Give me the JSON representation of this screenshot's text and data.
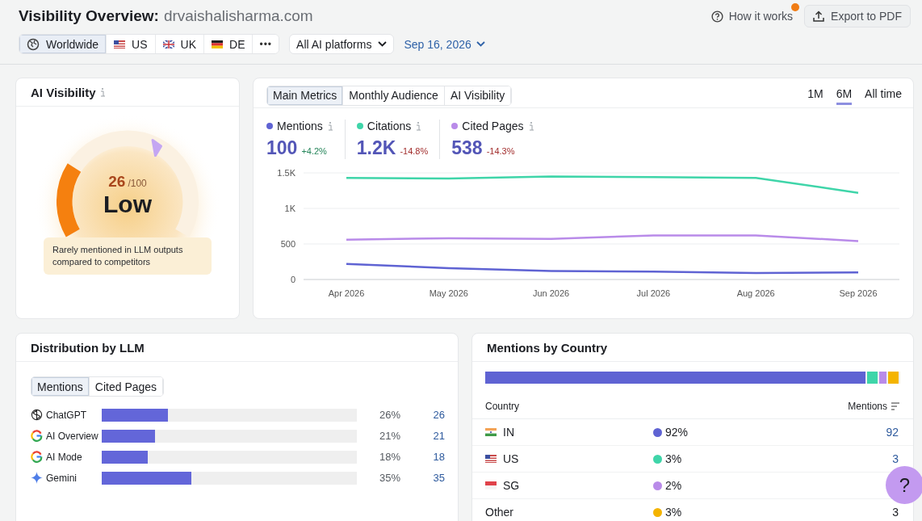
{
  "header": {
    "title": "Visibility Overview:",
    "domain": "drvaishalisharma.com",
    "regions": [
      {
        "label": "Worldwide",
        "kind": "globe",
        "selected": true
      },
      {
        "label": "US",
        "kind": "flag_us",
        "selected": false
      },
      {
        "label": "UK",
        "kind": "flag_uk",
        "selected": false
      },
      {
        "label": "DE",
        "kind": "flag_de",
        "selected": false
      }
    ],
    "more": "•••",
    "platform": "All AI platforms",
    "date": "Sep 16, 2026",
    "how_it_works": "How it works",
    "how_it_works_new": true,
    "export": "Export to PDF"
  },
  "ai_visibility": {
    "title": "AI Visibility",
    "score": "26",
    "max": "/100",
    "rating": "Low",
    "benchmark": {
      "level": 0.63
    },
    "description": "Rarely mentioned in LLM outputs compared to competitors"
  },
  "metrics_card": {
    "tabs": [
      {
        "label": "Main Metrics",
        "selected": true
      },
      {
        "label": "Monthly Audience",
        "selected": false
      },
      {
        "label": "AI Visibility",
        "selected": false
      }
    ],
    "ranges": [
      {
        "label": "1M",
        "selected": false
      },
      {
        "label": "6M",
        "selected": true
      },
      {
        "label": "All time",
        "selected": false
      }
    ],
    "metrics": [
      {
        "value": "100",
        "change": "+4.2%",
        "positive": true
      },
      {
        "value": "1.2K",
        "change": "-14.8%",
        "positive": false
      },
      {
        "value": "538",
        "change": "-14.3%",
        "positive": false
      }
    ],
    "chart_data": {
      "type": "line",
      "categories": [
        "Apr 2026",
        "May 2026",
        "Jun 2026",
        "Jul 2026",
        "Aug 2026",
        "Sep 2026"
      ],
      "series": [
        {
          "name": "Mentions",
          "color": "#5f63d3",
          "values": [
            220,
            160,
            120,
            110,
            90,
            100
          ]
        },
        {
          "name": "Citations",
          "color": "#3fd5a9",
          "values": [
            1430,
            1420,
            1450,
            1440,
            1430,
            1220
          ]
        },
        {
          "name": "Cited Pages",
          "color": "#b98be9",
          "values": [
            560,
            580,
            570,
            620,
            620,
            540
          ]
        }
      ],
      "ylim": [
        0,
        1500
      ],
      "yticks": [
        0,
        500,
        {
          "value": 1000,
          "label": "1K"
        },
        {
          "value": 1500,
          "label": "1.5K"
        }
      ]
    }
  },
  "distribution": {
    "title": "Distribution by LLM",
    "tabs": [
      {
        "label": "Mentions",
        "selected": true
      },
      {
        "label": "Cited Pages",
        "selected": false
      }
    ],
    "rows": [
      {
        "name": "ChatGPT",
        "kind": "openai",
        "level": 0.26,
        "percent": "26%",
        "value": "26"
      },
      {
        "name": "AI Overview",
        "kind": "google",
        "level": 0.21,
        "percent": "21%",
        "value": "21"
      },
      {
        "name": "AI Mode",
        "kind": "google",
        "level": 0.18,
        "percent": "18%",
        "value": "18"
      },
      {
        "name": "Gemini",
        "kind": "gemini",
        "level": 0.35,
        "percent": "35%",
        "value": "35"
      }
    ]
  },
  "countries": {
    "title": "Mentions by Country",
    "columns": [
      "Country",
      "Mentions"
    ],
    "rows": [
      {
        "name": "IN",
        "kind": "flag_in",
        "color": "#5f63d3",
        "percent": "92%",
        "value": "92",
        "link": true
      },
      {
        "name": "US",
        "kind": "flag_us",
        "color": "#3fd5a9",
        "percent": "3%",
        "value": "3",
        "link": true
      },
      {
        "name": "SG",
        "kind": "flag_sg",
        "color": "#b98be9",
        "percent": "2%"
      },
      {
        "name": "Other",
        "kind": "none",
        "color": "#f4b400",
        "percent": "3%",
        "value": "3",
        "link": false
      }
    ]
  },
  "help_button": "?"
}
